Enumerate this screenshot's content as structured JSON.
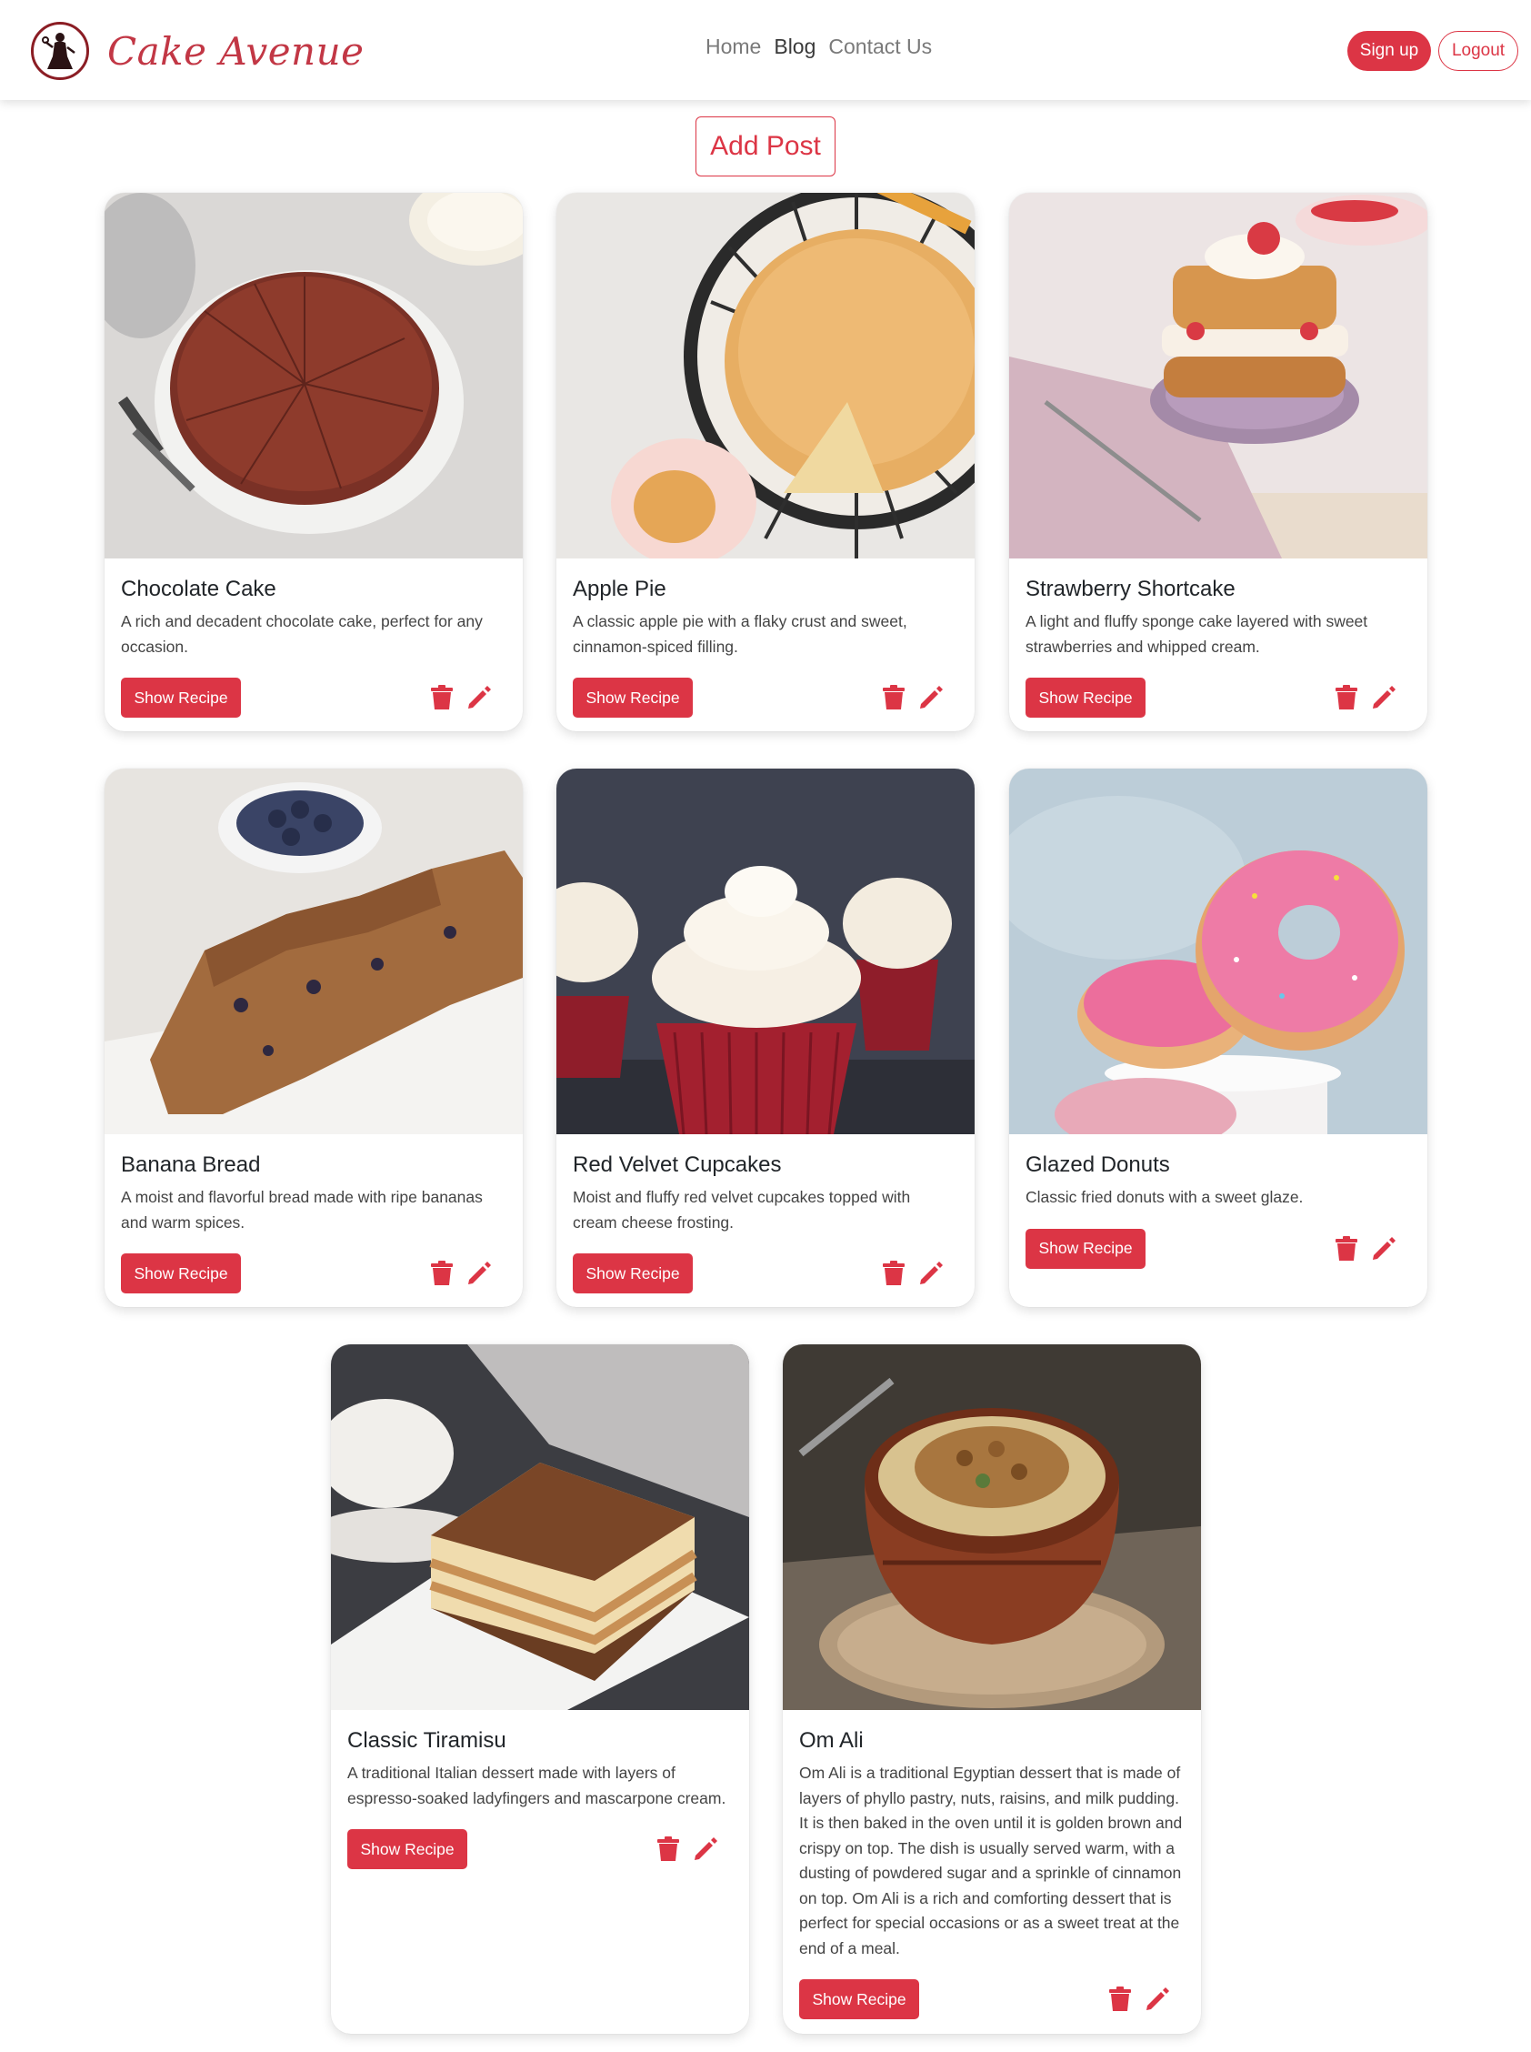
{
  "brand": {
    "name": "Cake Avenue",
    "logo_icon": "baker-silhouette-logo-icon"
  },
  "nav": {
    "links": [
      {
        "label": "Home"
      },
      {
        "label": "Blog"
      },
      {
        "label": "Contact Us"
      }
    ],
    "active": "Blog"
  },
  "auth": {
    "signup_label": "Sign up",
    "logout_label": "Logout"
  },
  "add_post_label": "Add Post",
  "colors": {
    "accent": "#dc3545",
    "brand": "#c23745"
  },
  "cards": [
    {
      "title": "Chocolate Cake",
      "description": "A rich and decadent chocolate cake, perfect for any occasion.",
      "button": "Show Recipe",
      "image": "chocolate-cake-photo"
    },
    {
      "title": "Apple Pie",
      "description": "A classic apple pie with a flaky crust and sweet, cinnamon-spiced filling.",
      "button": "Show Recipe",
      "image": "apple-pie-photo"
    },
    {
      "title": "Strawberry Shortcake",
      "description": "A light and fluffy sponge cake layered with sweet strawberries and whipped cream.",
      "button": "Show Recipe",
      "image": "strawberry-shortcake-photo"
    },
    {
      "title": "Banana Bread",
      "description": "A moist and flavorful bread made with ripe bananas and warm spices.",
      "button": "Show Recipe",
      "image": "banana-bread-photo"
    },
    {
      "title": "Red Velvet Cupcakes",
      "description": "Moist and fluffy red velvet cupcakes topped with cream cheese frosting.",
      "button": "Show Recipe",
      "image": "red-velvet-cupcakes-photo"
    },
    {
      "title": "Glazed Donuts",
      "description": "Classic fried donuts with a sweet glaze.",
      "button": "Show Recipe",
      "image": "glazed-donuts-photo"
    },
    {
      "title": "Classic Tiramisu",
      "description": "A traditional Italian dessert made with layers of espresso-soaked ladyfingers and mascarpone cream.",
      "button": "Show Recipe",
      "image": "tiramisu-photo"
    },
    {
      "title": "Om Ali",
      "description": "Om Ali is a traditional Egyptian dessert that is made of layers of phyllo pastry, nuts, raisins, and milk pudding. It is then baked in the oven until it is golden brown and crispy on top. The dish is usually served warm, with a dusting of powdered sugar and a sprinkle of cinnamon on top. Om Ali is a rich and comforting dessert that is perfect for special occasions or as a sweet treat at the end of a meal.",
      "button": "Show Recipe",
      "image": "om-ali-photo"
    }
  ],
  "card_icons": {
    "delete": "trash-icon",
    "edit": "pencil-icon"
  }
}
